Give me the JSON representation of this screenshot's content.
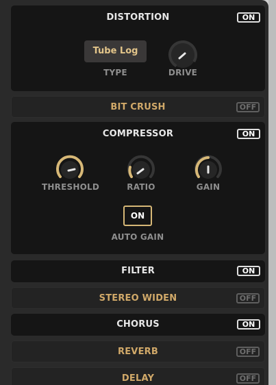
{
  "sections": {
    "distortion": {
      "title": "DISTORTION",
      "toggle": "ON"
    },
    "bitcrush": {
      "title": "BIT CRUSH",
      "toggle": "OFF"
    },
    "compressor": {
      "title": "COMPRESSOR",
      "toggle": "ON"
    },
    "filter": {
      "title": "FILTER",
      "toggle": "ON"
    },
    "stereo": {
      "title": "STEREO WIDEN",
      "toggle": "OFF"
    },
    "chorus": {
      "title": "CHORUS",
      "toggle": "ON"
    },
    "reverb": {
      "title": "REVERB",
      "toggle": "OFF"
    },
    "delay": {
      "title": "DELAY",
      "toggle": "OFF"
    }
  },
  "distortion_controls": {
    "type_value": "Tube Log",
    "type_label": "TYPE",
    "drive_label": "DRIVE"
  },
  "compressor_controls": {
    "threshold_label": "THRESHOLD",
    "ratio_label": "RATIO",
    "gain_label": "GAIN",
    "auto_gain_value": "ON",
    "auto_gain_label": "AUTO GAIN"
  },
  "colors": {
    "accent": "#d7b877",
    "panel_active": "#151515",
    "panel_inactive": "#232323"
  }
}
